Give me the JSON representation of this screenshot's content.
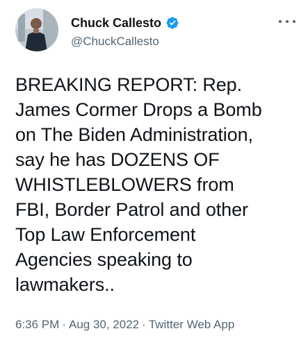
{
  "author": {
    "display_name": "Chuck Callesto",
    "handle": "@ChuckCallesto",
    "verified": true,
    "verified_icon": "verified-badge-icon",
    "avatar_icon": "profile-photo"
  },
  "more_icon": "more-options-icon",
  "tweet": {
    "text": "BREAKING REPORT: Rep.\nJames Cormer Drops a Bomb\non The Biden Administration,\nsay he has DOZENS OF\nWHISTLEBLOWERS from\nFBI, Border Patrol and other\nTop Law Enforcement\nAgencies speaking to\nlawmakers.."
  },
  "meta": {
    "time": "6:36 PM",
    "separator": "·",
    "date": "Aug 30, 2022",
    "source": "Twitter Web App"
  },
  "colors": {
    "verified_blue": "#1d9bf0",
    "text_primary": "#0f1419",
    "text_secondary": "#536471"
  }
}
